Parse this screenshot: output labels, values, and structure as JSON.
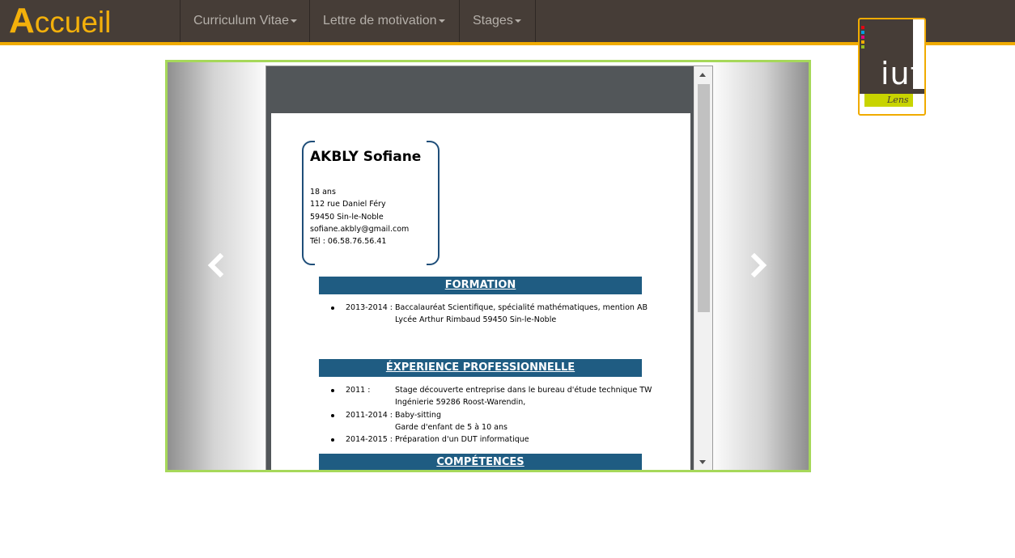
{
  "navbar": {
    "brand": "Accueil",
    "items": [
      {
        "label": "Curriculum Vitae"
      },
      {
        "label": "Lettre de motivation"
      },
      {
        "label": "Stages"
      }
    ]
  },
  "logo": {
    "word": "iut",
    "city": "Lens"
  },
  "cv": {
    "name": "AKBLY Sofiane",
    "age": "18 ans",
    "street": "112 rue Daniel Féry",
    "city": "59450 Sin-le-Noble",
    "email": "sofiane.akbly@gmail.com",
    "phone": "Tél : 06.58.76.56.41",
    "sections": {
      "formation": "FORMATION",
      "experience": "ÉXPERIENCE PROFESSIONNELLE",
      "competences": "COMPÉTENCES"
    },
    "formation_items": [
      {
        "date": "2013-2014 :",
        "desc": "Baccalauréat Scientifique, spécialité mathématiques, mention AB",
        "desc2": "Lycée Arthur Rimbaud 59450 Sin-le-Noble"
      }
    ],
    "experience_items": [
      {
        "date": "2011 :",
        "desc": "Stage découverte entreprise dans le bureau d'étude technique TW",
        "desc2": "Ingénierie 59286 Roost-Warendin,"
      },
      {
        "date": "2011-2014 :",
        "desc": "Baby-sitting",
        "desc2": "Garde d'enfant de 5 à 10 ans"
      },
      {
        "full": "2014-2015 : Préparation d'un DUT informatique"
      }
    ]
  },
  "colors": {
    "navbar": "#463d37",
    "accent": "#f0ab00",
    "section": "#1f5c82",
    "carousel_border": "#a6d85a"
  },
  "icons": {
    "prev": "chevron-left-icon",
    "next": "chevron-right-icon"
  }
}
